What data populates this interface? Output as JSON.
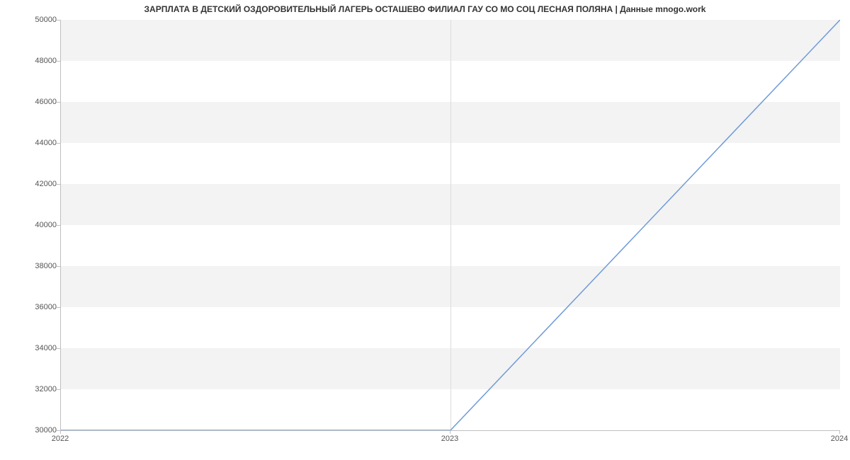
{
  "chart_data": {
    "type": "line",
    "title": "ЗАРПЛАТА В ДЕТСКИЙ ОЗДОРОВИТЕЛЬНЫЙ ЛАГЕРЬ ОСТАШЕВО ФИЛИАЛ ГАУ СО МО СОЦ ЛЕСНАЯ ПОЛЯНА | Данные mnogo.work",
    "x": [
      2022,
      2023,
      2024
    ],
    "values": [
      30000,
      30000,
      50000
    ],
    "xlabel": "",
    "ylabel": "",
    "ylim": [
      30000,
      50000
    ],
    "xlim": [
      2022,
      2024
    ],
    "y_ticks": [
      30000,
      32000,
      34000,
      36000,
      38000,
      40000,
      42000,
      44000,
      46000,
      48000,
      50000
    ],
    "x_ticks": [
      2022,
      2023,
      2024
    ],
    "line_color": "#6f9bd8"
  }
}
